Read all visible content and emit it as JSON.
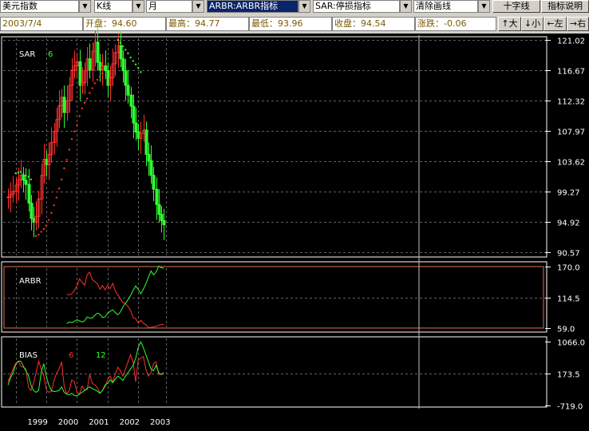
{
  "toolbar": {
    "index_select": "美元指数",
    "chart_type_select": "K线",
    "period_select": "月",
    "indicator1_select": "ARBR:ARBR指标",
    "indicator2_select": "SAR:停损指标",
    "clear_select": "清除画线",
    "crosshair_button": "十字线",
    "indicator_help_button": "指标说明"
  },
  "info": {
    "date": "2003/7/4",
    "open": "开盘：94.60",
    "high": "最高：94.77",
    "low": "最低：93.96",
    "close": "收盘：94.54",
    "change": "涨跌：-0.06"
  },
  "nav": {
    "zoom_in": "↑大",
    "zoom_out": "↓小",
    "left": "←左",
    "right": "→右"
  },
  "colors": {
    "up": "#ff3030",
    "down": "#30ff30",
    "sar": "#ff3030",
    "grid": "#606060",
    "axis": "#ffffff"
  },
  "chart_data": [
    {
      "type": "candlestick",
      "title": "SAR",
      "param": "6",
      "y_ticks": [
        "121.02",
        "116.67",
        "112.32",
        "107.97",
        "103.62",
        "99.27",
        "94.92",
        "90.57"
      ],
      "ylim": [
        90.57,
        121.02
      ],
      "series": [
        {
          "name": "price",
          "values": [
            98.5,
            98.9,
            99.3,
            100.2,
            101.0,
            101.6,
            100.9,
            100.3,
            97.6,
            95.4,
            94.9,
            95.7,
            98.2,
            101.6,
            103.9,
            103.1,
            104.6,
            106.3,
            107.9,
            109.6,
            111.6,
            112.8,
            110.6,
            112.3,
            114.5,
            116.7,
            117.3,
            117.9,
            114.5,
            114.9,
            116.6,
            118.3,
            116.7,
            119.4,
            120.7,
            117.8,
            116.7,
            117.3,
            116.6,
            114.5,
            115.6,
            117.6,
            119.2,
            120.2,
            118.3,
            116.6,
            114.5,
            113.1,
            111.5,
            109.1,
            107.8,
            106.9,
            107.6,
            108.1,
            104.6,
            103.7,
            101.6,
            99.6,
            97.4,
            96.0,
            95.1,
            94.5
          ]
        },
        {
          "name": "sar",
          "values": [
            null,
            null,
            null,
            101.9,
            102.0,
            102.1,
            101.8,
            101.6,
            101.4,
            101.0,
            null,
            92.9,
            93.1,
            93.5,
            93.9,
            94.4,
            95.2,
            96.2,
            97.3,
            98.4,
            99.7,
            101.0,
            102.6,
            103.8,
            105.3,
            106.8,
            107.9,
            108.8,
            110.1,
            111.2,
            112.0,
            112.6,
            113.4,
            114.1,
            114.8,
            115.3,
            115.7,
            116.2,
            null,
            null,
            null,
            null,
            null,
            121.0,
            120.6,
            120.1,
            119.6,
            119.1,
            118.5,
            118.0,
            117.5,
            117.0,
            116.4,
            null,
            null,
            null,
            null,
            null,
            null,
            null,
            null,
            null
          ]
        }
      ]
    },
    {
      "type": "line",
      "title": "ARBR",
      "y_ticks": [
        "170.0",
        "114.5",
        "59.0"
      ],
      "ylim": [
        59.0,
        170.0
      ],
      "series": [
        {
          "name": "AR",
          "values": [
            null,
            null,
            null,
            null,
            null,
            null,
            null,
            null,
            null,
            null,
            null,
            null,
            null,
            null,
            null,
            null,
            null,
            null,
            null,
            null,
            null,
            null,
            null,
            120,
            119,
            121,
            127,
            135,
            148,
            142,
            136,
            155,
            160,
            146,
            143,
            139,
            129,
            136,
            128,
            136,
            130,
            140,
            126,
            119,
            112,
            105,
            103,
            98,
            91,
            78,
            76,
            68,
            73,
            68,
            65,
            60,
            60,
            61,
            62,
            64,
            65,
            66
          ]
        },
        {
          "name": "BR",
          "values": [
            null,
            null,
            null,
            null,
            null,
            null,
            null,
            null,
            null,
            null,
            null,
            null,
            null,
            null,
            null,
            null,
            null,
            null,
            null,
            null,
            null,
            null,
            null,
            67,
            70,
            69,
            71,
            74,
            72,
            70,
            72,
            79,
            77,
            77,
            82,
            86,
            84,
            78,
            79,
            86,
            89,
            92,
            87,
            83,
            88,
            97,
            104,
            110,
            118,
            127,
            135,
            129,
            121,
            129,
            139,
            151,
            162,
            155,
            160,
            171,
            168,
            167
          ]
        }
      ]
    },
    {
      "type": "line",
      "title": "BIAS",
      "series_labels": [
        "6",
        "12"
      ],
      "y_ticks": [
        "1066.0",
        "173.5",
        "-719.0"
      ],
      "ylim": [
        -719.0,
        1066.0
      ],
      "series": [
        {
          "name": "BIAS6",
          "values": [
            -50,
            120,
            300,
            450,
            520,
            380,
            350,
            300,
            -200,
            -300,
            -100,
            200,
            520,
            300,
            120,
            -280,
            -350,
            -330,
            -20,
            180,
            300,
            500,
            -180,
            -400,
            -300,
            0,
            -60,
            -350,
            -400,
            -180,
            -290,
            -280,
            150,
            -100,
            -140,
            -220,
            -380,
            -300,
            -200,
            0,
            100,
            -60,
            150,
            350,
            250,
            100,
            300,
            500,
            700,
            500,
            -50,
            550,
            600,
            650,
            300,
            100,
            200,
            450,
            500,
            150,
            150,
            170
          ]
        },
        {
          "name": "BIAS12",
          "values": [
            -150,
            50,
            200,
            420,
            520,
            520,
            380,
            250,
            120,
            -150,
            -300,
            -350,
            -300,
            200,
            450,
            100,
            -150,
            -300,
            -330,
            -320,
            -300,
            -200,
            -350,
            -400,
            -420,
            -380,
            -440,
            -450,
            -400,
            -350,
            -300,
            -240,
            -200,
            -250,
            -280,
            -320,
            -380,
            -300,
            -150,
            -100,
            0,
            -80,
            20,
            100,
            50,
            -20,
            100,
            200,
            300,
            400,
            600,
            900,
            1060,
            900,
            700,
            500,
            300,
            250,
            400,
            200,
            150,
            200
          ]
        }
      ]
    },
    {
      "type": "axis",
      "x_labels": [
        "1999",
        "2000",
        "2001",
        "2002",
        "2003"
      ]
    }
  ]
}
